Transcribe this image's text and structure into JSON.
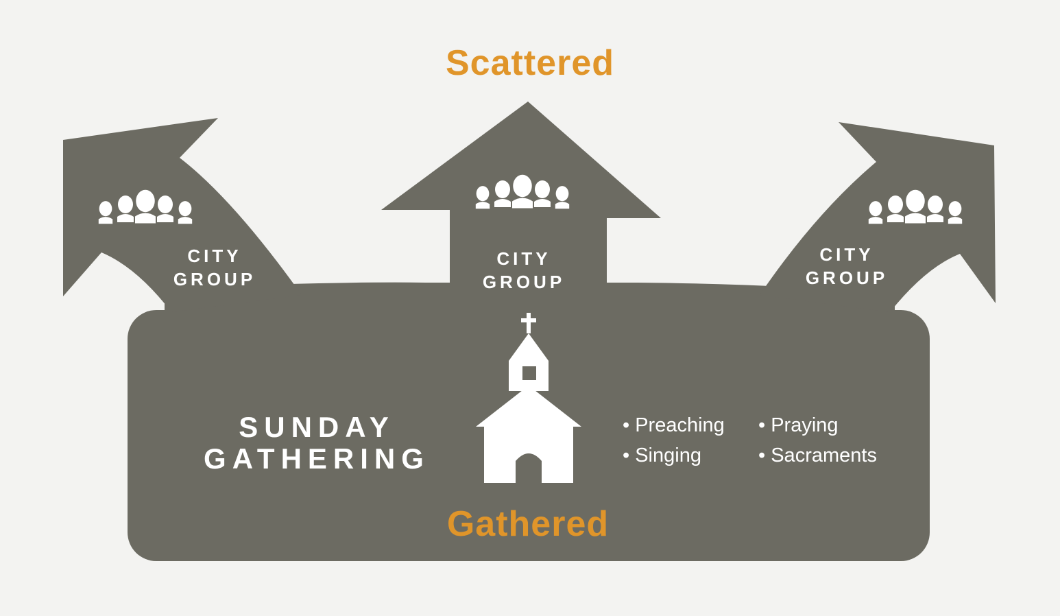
{
  "titles": {
    "scattered": "Scattered",
    "gathered": "Gathered"
  },
  "groups": [
    {
      "line1": "CITY",
      "line2": "GROUP"
    },
    {
      "line1": "CITY",
      "line2": "GROUP"
    },
    {
      "line1": "CITY",
      "line2": "GROUP"
    }
  ],
  "gathering": {
    "line1": "SUNDAY",
    "line2": "GATHERING"
  },
  "activities": {
    "left": [
      "Preaching",
      "Singing"
    ],
    "right": [
      "Praying",
      "Sacraments"
    ]
  },
  "icons": {
    "people": "people-group-icon",
    "church": "church-icon"
  },
  "colors": {
    "shape": "#6c6b62",
    "accent": "#e0952a",
    "text": "#ffffff",
    "background": "#f3f3f1"
  }
}
